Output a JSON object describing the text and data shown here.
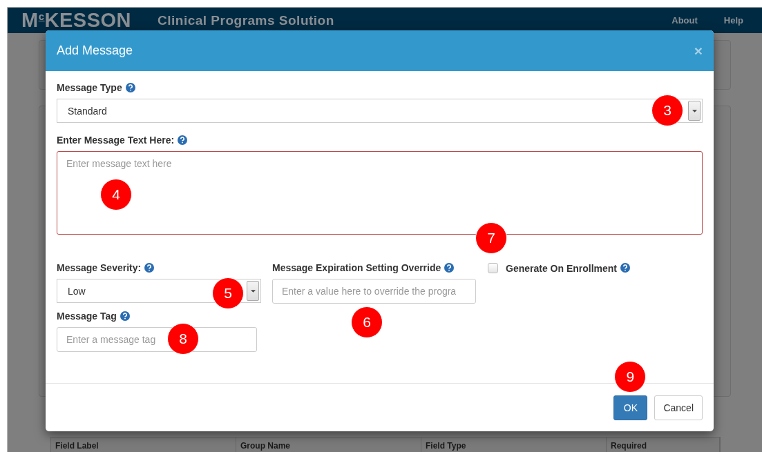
{
  "header": {
    "logo": "M$^{c}$KESSON",
    "title": "Clinical Programs Solution",
    "links": [
      "About",
      "Help"
    ]
  },
  "background_table": {
    "columns": [
      "Field Label",
      "Group Name",
      "Field Type",
      "Required"
    ]
  },
  "dialog": {
    "title": "Add Message",
    "close": "×",
    "message_type": {
      "label": "Message Type",
      "value": "Standard",
      "callout": "3"
    },
    "message_text": {
      "label": "Enter Message Text Here:",
      "placeholder": "Enter message text here",
      "invalid": true,
      "callout": "4"
    },
    "severity": {
      "label": "Message Severity:",
      "value": "Low",
      "callout": "5"
    },
    "expiration": {
      "label": "Message Expiration Setting Override",
      "placeholder": "Enter a value here to override the progra",
      "callout": "6"
    },
    "generate_on_enrollment": {
      "label": "Generate On Enrollment",
      "checked": false,
      "callout": "7"
    },
    "tag": {
      "label": "Message Tag",
      "placeholder": "Enter a message tag",
      "callout": "8"
    },
    "buttons": [
      {
        "label": "OK",
        "kind": "primary",
        "callout": "9"
      },
      {
        "label": "Cancel",
        "kind": "default"
      }
    ]
  }
}
